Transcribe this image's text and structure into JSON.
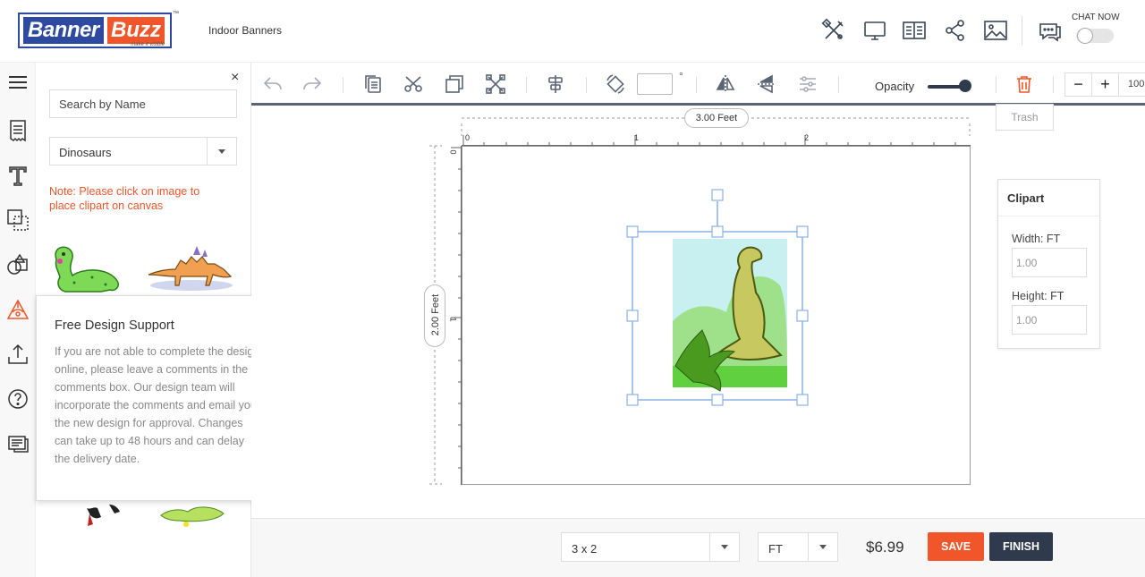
{
  "brand": {
    "part1": "Banner",
    "part2": "Buzz",
    "tagline": "make it visible",
    "tm": "™"
  },
  "header": {
    "product": "Indoor Banners",
    "chat_label": "CHAT NOW"
  },
  "panel": {
    "search_placeholder": "Search by Name",
    "category": "Dinosaurs",
    "note": "Note: Please click on image to place clipart on canvas",
    "close": "×"
  },
  "support": {
    "title": "Free Design Support",
    "body": "If you are not able to complete the design online, please leave a comments in the comments box. Our design team will incorporate the comments and email you the new design for approval. Changes can take up to 48 hours and can delay the delivery date.",
    "close": "×"
  },
  "toolbar": {
    "degree_symbol": "°",
    "opacity_label": "Opacity",
    "opacity_value": 1.0,
    "zoom_minus": "−",
    "zoom_plus": "+",
    "zoom_value": "100",
    "trash_tooltip": "Trash"
  },
  "canvas": {
    "width_label": "3.00 Feet",
    "height_label": "2.00 Feet",
    "ruler_top": [
      "0",
      "1",
      "2"
    ],
    "ruler_left": [
      "0",
      "1"
    ]
  },
  "clipart_panel": {
    "title": "Clipart",
    "width_label": "Width: FT",
    "width_value": "1.00",
    "height_label": "Height: FT",
    "height_value": "1.00"
  },
  "footer": {
    "size": "3 x 2",
    "unit": "FT",
    "price": "$6.99",
    "save": "SAVE",
    "finish": "FINISH"
  },
  "colors": {
    "brand_blue": "#2d4aa0",
    "accent_orange": "#f0562a",
    "dark": "#2f3a4c"
  }
}
